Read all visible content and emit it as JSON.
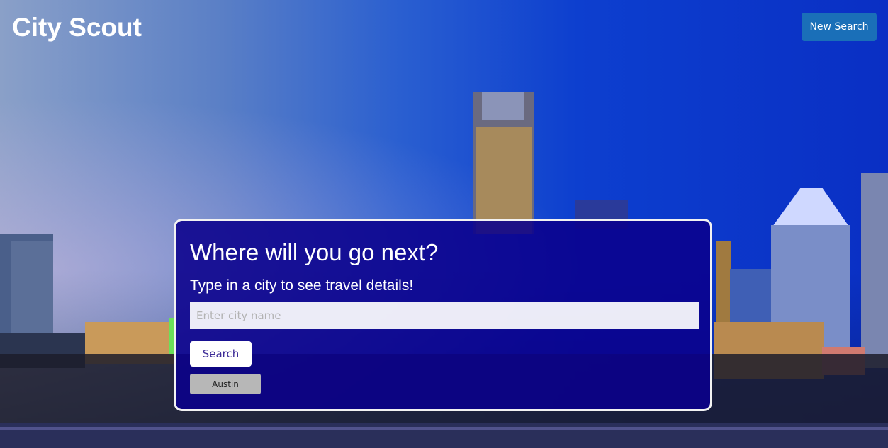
{
  "header": {
    "title": "City Scout",
    "new_search_label": "New Search"
  },
  "panel": {
    "heading": "Where will you go next?",
    "subheading": "Type in a city to see travel details!",
    "input_placeholder": "Enter city name",
    "input_value": "",
    "search_label": "Search",
    "history": [
      "Austin"
    ]
  },
  "colors": {
    "panel_background": "#0a008c",
    "new_search_button": "#1a6fb8",
    "history_button": "#b7b7b7"
  }
}
